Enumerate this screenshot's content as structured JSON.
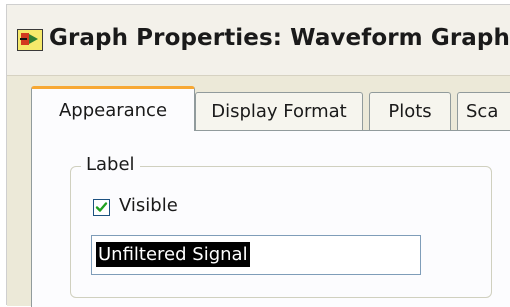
{
  "window": {
    "title": "Graph Properties: Waveform Graph",
    "icon": "labview-vi-icon"
  },
  "tabs": [
    {
      "label": "Appearance",
      "active": true
    },
    {
      "label": "Display Format",
      "active": false
    },
    {
      "label": "Plots",
      "active": false
    },
    {
      "label": "Sca",
      "active": false
    }
  ],
  "label_group": {
    "title": "Label",
    "visible_checkbox": {
      "label": "Visible",
      "checked": true
    },
    "text_field": {
      "value": "Unfiltered Signal",
      "selected": true
    }
  },
  "colors": {
    "tab_accent": "#f7a833",
    "checkmark": "#21a121",
    "selection_bg": "#000000"
  }
}
